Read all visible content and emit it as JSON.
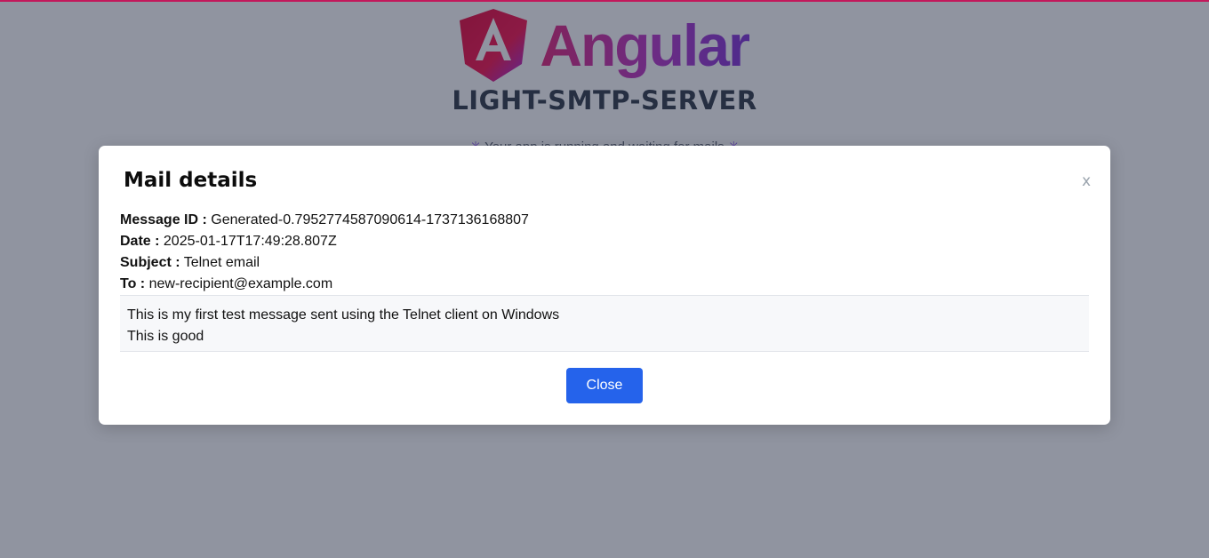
{
  "header": {
    "logo_word": "Angular",
    "app_name": "LIGHT-SMTP-SERVER",
    "tagline": "Your app is running and waiting for mails"
  },
  "modal": {
    "title": "Mail details",
    "close_x": "x",
    "fields": [
      {
        "label": "Message ID :",
        "value": "Generated-0.7952774587090614-1737136168807"
      },
      {
        "label": "Date :",
        "value": "2025-01-17T17:49:28.807Z"
      },
      {
        "label": "Subject :",
        "value": "Telnet email"
      },
      {
        "label": "To :",
        "value": "new-recipient@example.com"
      }
    ],
    "body_lines": [
      "This is my first test message sent using the Telnet client on Windows",
      "This is good"
    ],
    "close_button": "Close"
  },
  "colors": {
    "accent_top_border": "#c2185b",
    "primary_button": "#2563eb",
    "overlay": "rgba(33,41,66,0.5)"
  },
  "icons": {
    "logo": "angular-logo-icon",
    "tagline_decor": "sparkle-icon"
  }
}
